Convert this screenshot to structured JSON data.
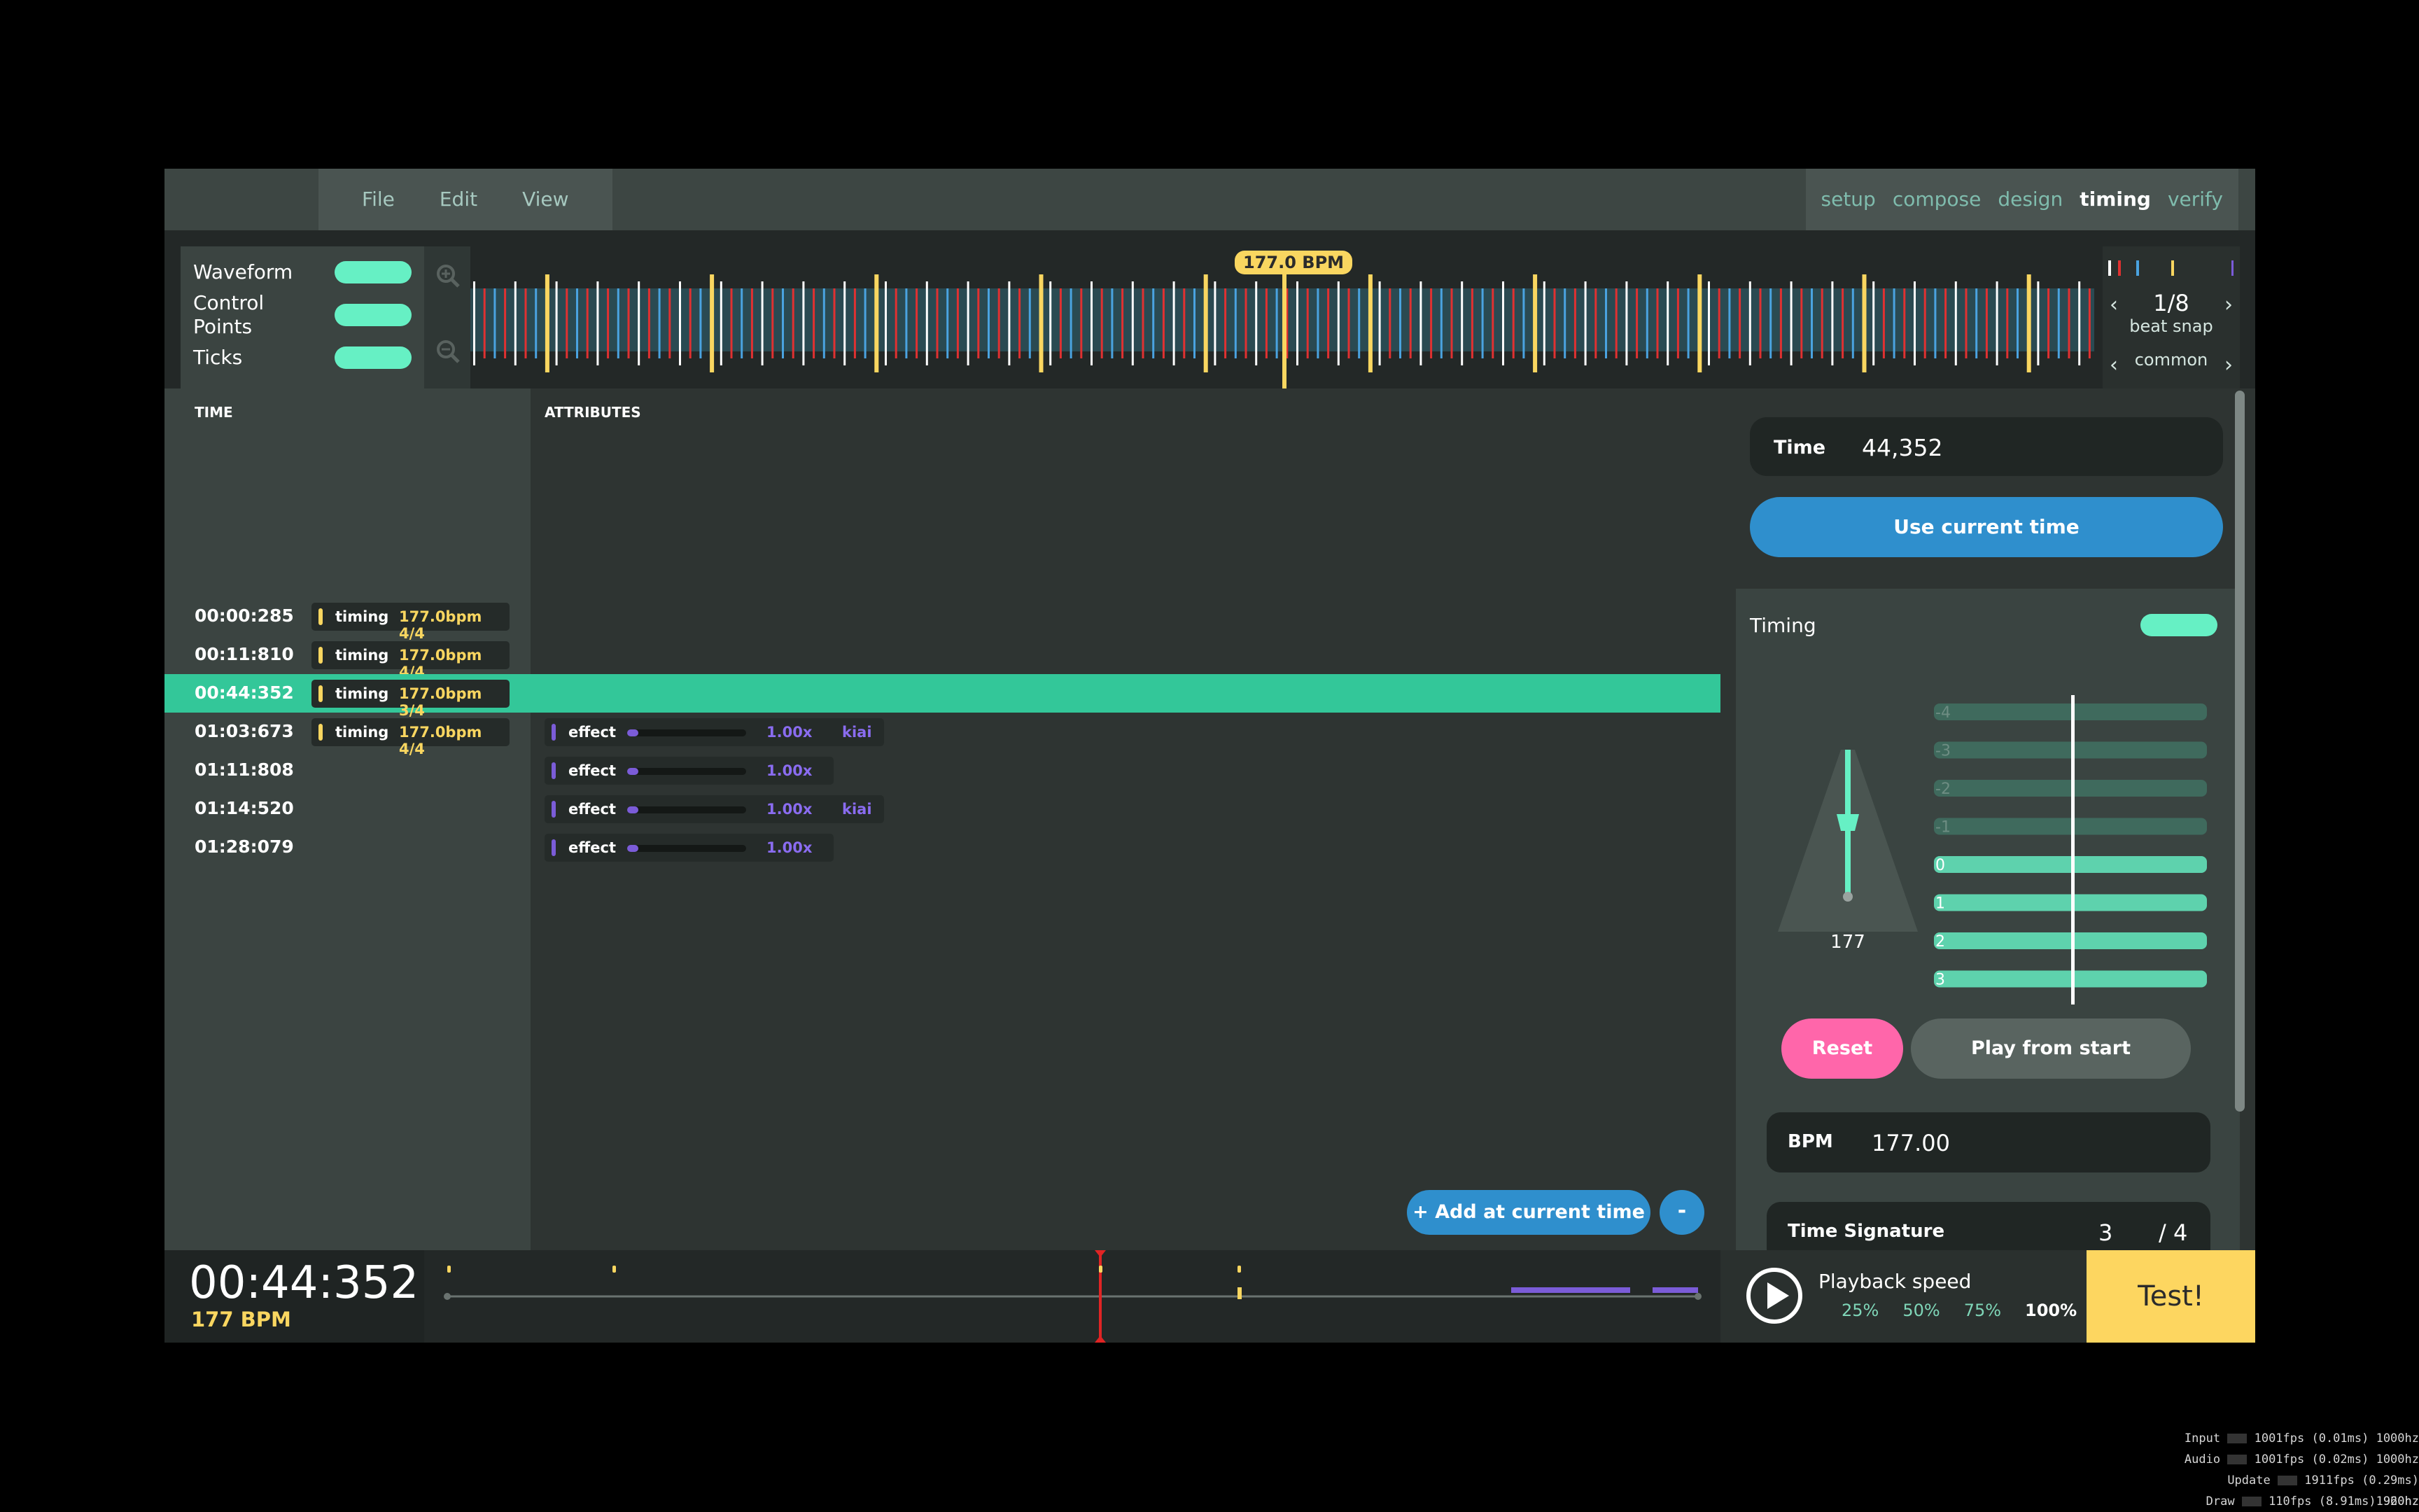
{
  "menu": {
    "items": [
      "File",
      "Edit",
      "View"
    ]
  },
  "modes": {
    "items": [
      "setup",
      "compose",
      "design",
      "timing",
      "verify"
    ],
    "active": "timing"
  },
  "timeline": {
    "toggles": [
      {
        "label": "Waveform"
      },
      {
        "label": "Control Points"
      },
      {
        "label": "Ticks"
      }
    ],
    "bpm_marker": "177.0 BPM",
    "beat_snap": {
      "value": "1/8",
      "label": "beat snap",
      "preset": "common"
    }
  },
  "columns": {
    "time": "TIME",
    "attributes": "ATTRIBUTES"
  },
  "control_points": [
    {
      "time": "00:00:285",
      "group": {
        "type": "timing",
        "value": "177.0bpm 4/4"
      }
    },
    {
      "time": "00:11:810",
      "group": {
        "type": "timing",
        "value": "177.0bpm 4/4"
      }
    },
    {
      "time": "00:44:352",
      "selected": true,
      "group": {
        "type": "timing",
        "value": "177.0bpm 3/4"
      }
    },
    {
      "time": "01:03:673",
      "group": {
        "type": "timing",
        "value": "177.0bpm 4/4"
      },
      "effect": {
        "type": "effect",
        "speed": "1.00x",
        "kiai": "kiai"
      }
    },
    {
      "time": "01:11:808",
      "effect": {
        "type": "effect",
        "speed": "1.00x"
      }
    },
    {
      "time": "01:14:520",
      "effect": {
        "type": "effect",
        "speed": "1.00x",
        "kiai": "kiai"
      }
    },
    {
      "time": "01:28:079",
      "effect": {
        "type": "effect",
        "speed": "1.00x"
      }
    }
  ],
  "actions": {
    "add": "+ Add at current time",
    "remove": "-"
  },
  "panel": {
    "time_label": "Time",
    "time_value": "44,352",
    "use_current": "Use current time",
    "timing_title": "Timing",
    "metronome_bpm": "177",
    "beat_labels": [
      "-4",
      "-3",
      "-2",
      "-1",
      "0",
      "1",
      "2",
      "3"
    ],
    "reset": "Reset",
    "play_from_start": "Play from start",
    "bpm_label": "BPM",
    "bpm_value": "177.00",
    "sig_label": "Time Signature",
    "sig_num": "3",
    "sig_den": "/ 4"
  },
  "bottom": {
    "clock": "00:44:352",
    "bpm": "177 BPM",
    "playback_label": "Playback speed",
    "speeds": [
      "25%",
      "50%",
      "75%",
      "100%"
    ],
    "active_speed": "100%",
    "test": "Test!"
  },
  "fps": [
    {
      "label": "Input",
      "text": "1001fps (0.01ms) 1000hz"
    },
    {
      "label": "Audio",
      "text": "1001fps (0.02ms) 1000hz"
    },
    {
      "label": "Update",
      "text": "1911fps (0.29ms) 1920hz"
    },
    {
      "label": "Draw",
      "text": "110fps (8.91ms) 960hz"
    }
  ],
  "colors": {
    "accent": "#66f0c4",
    "selected_row": "#33c799",
    "timing": "#f9d660",
    "effect": "#7b5cd8",
    "action_blue": "#2f8fcd",
    "reset_pink": "#ff66aa",
    "test_yellow": "#fdd660"
  }
}
